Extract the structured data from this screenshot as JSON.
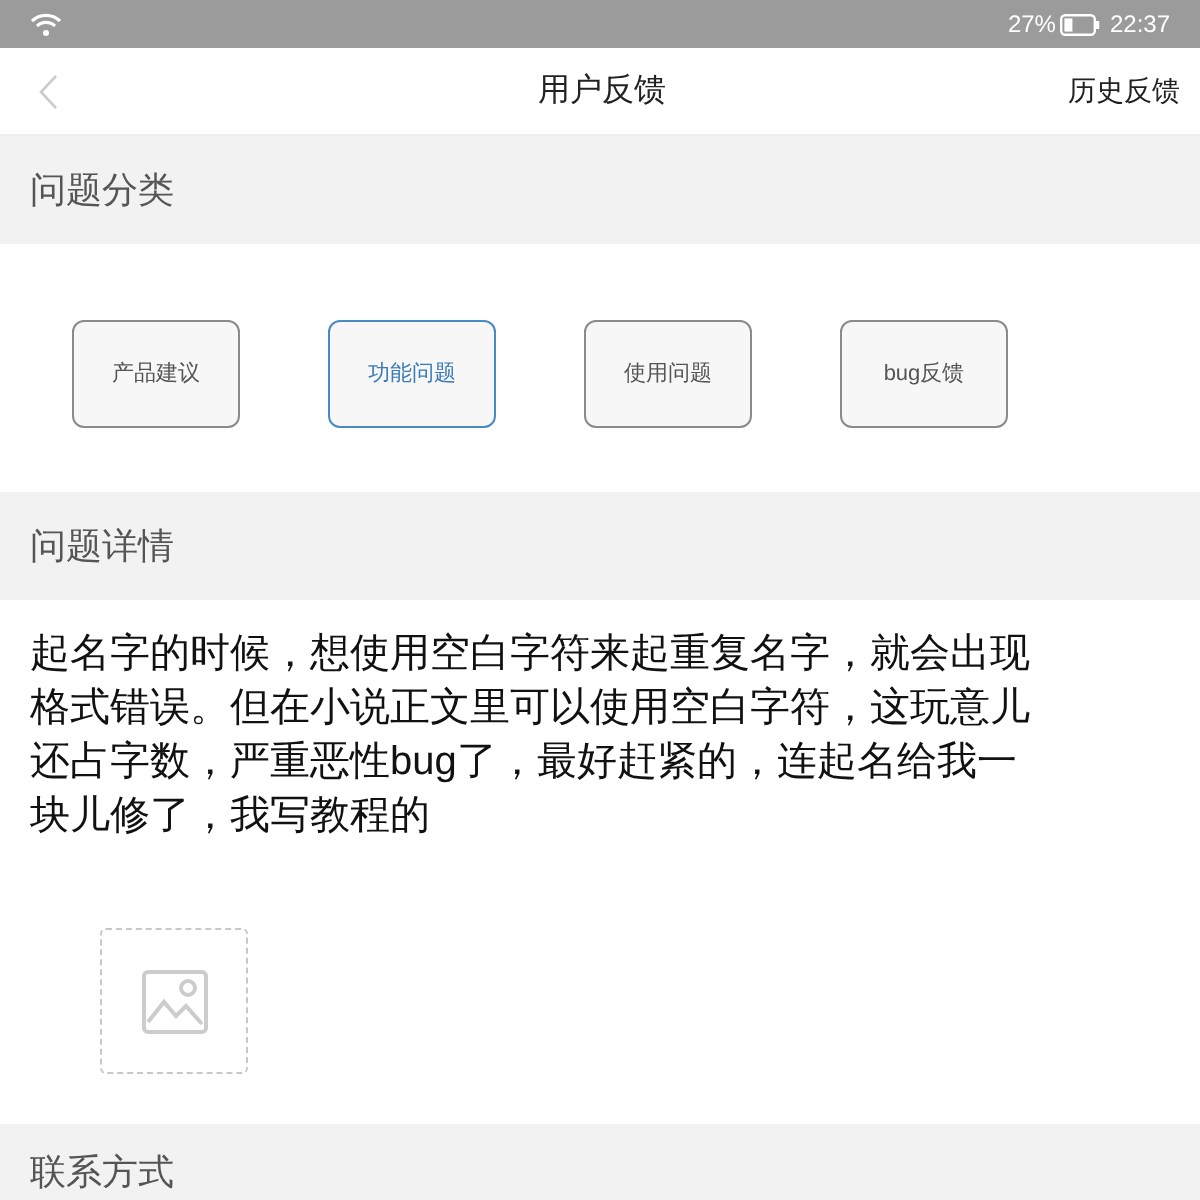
{
  "status_bar": {
    "battery": "27%",
    "time": "22:37"
  },
  "nav": {
    "title": "用户反馈",
    "action": "历史反馈"
  },
  "category_section": {
    "title": "问题分类",
    "categories": [
      {
        "label": "产品建议",
        "selected": false
      },
      {
        "label": "功能问题",
        "selected": true
      },
      {
        "label": "使用问题",
        "selected": false
      },
      {
        "label": "bug反馈",
        "selected": false
      }
    ]
  },
  "detail_section": {
    "title": "问题详情",
    "value": "起名字的时候，想使用空白字符来起重复名字，就会出现格式错误。但在小说正文里可以使用空白字符，这玩意儿还占字数，严重恶性bug了，最好赶紧的，连起名给我一块儿修了，我写教程的"
  },
  "contact_section": {
    "title": "联系方式"
  }
}
